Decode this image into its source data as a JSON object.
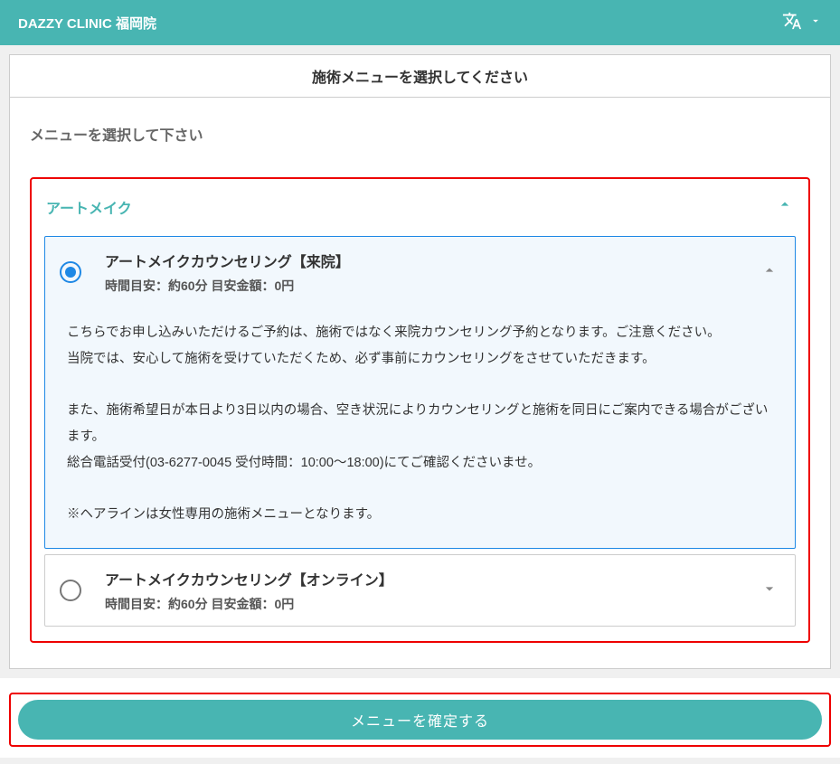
{
  "header": {
    "title": "DAZZY CLINIC 福岡院"
  },
  "instruction": "施術メニューを選択してください",
  "section_label": "メニューを選択して下さい",
  "category": {
    "title": "アートメイク",
    "options": [
      {
        "title": "アートメイクカウンセリング【来院】",
        "sub": "時間目安：約60分  目安金額：0円",
        "detail": {
          "p1": "こちらでお申し込みいただけるご予約は、施術ではなく来院カウンセリング予約となります。ご注意ください。",
          "p2": "当院では、安心して施術を受けていただくため、必ず事前にカウンセリングをさせていただきます。",
          "p3": "また、施術希望日が本日より3日以内の場合、空き状況によりカウンセリングと施術を同日にご案内できる場合がございます。",
          "p4": "総合電話受付(03-6277-0045 受付時間：10:00〜18:00)にてご確認くださいませ。",
          "p5": "※ヘアラインは女性専用の施術メニューとなります。"
        }
      },
      {
        "title": "アートメイクカウンセリング【オンライン】",
        "sub": "時間目安：約60分  目安金額：0円"
      }
    ]
  },
  "footer": {
    "confirm": "メニューを確定する"
  }
}
